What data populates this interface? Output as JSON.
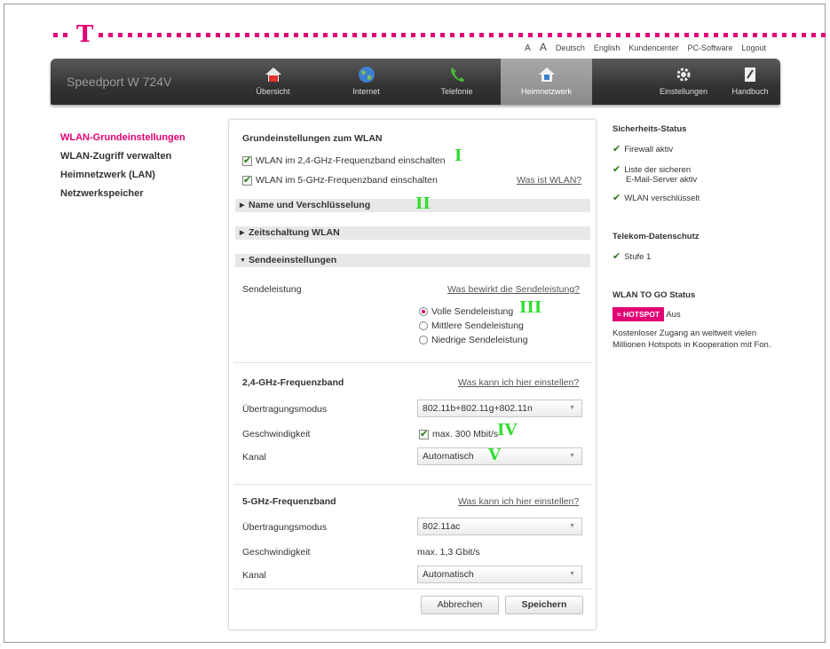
{
  "brand": {
    "logo_letter": "T",
    "accent": "#e20074"
  },
  "toplinks": {
    "font_small": "A",
    "font_large": "A",
    "deutsch": "Deutsch",
    "english": "English",
    "kundencenter": "Kundencenter",
    "pc_software": "PC-Software",
    "logout": "Logout"
  },
  "nav": {
    "product": "Speedport W 724V",
    "tabs": [
      {
        "label": "Übersicht",
        "icon": "home-icon"
      },
      {
        "label": "Internet",
        "icon": "globe-icon"
      },
      {
        "label": "Telefonie",
        "icon": "phone-icon"
      },
      {
        "label": "Heimnetzwerk",
        "icon": "home-network-icon",
        "active": true
      },
      {
        "label": "Einstellungen",
        "icon": "gear-icon"
      },
      {
        "label": "Handbuch",
        "icon": "manual-icon"
      }
    ]
  },
  "leftnav": {
    "items": [
      {
        "label": "WLAN-Grundeinstellungen",
        "active": true
      },
      {
        "label": "WLAN-Zugriff verwalten"
      },
      {
        "label": "Heimnetzwerk (LAN)"
      },
      {
        "label": "Netzwerkspeicher"
      }
    ]
  },
  "main": {
    "title": "Grundeinstellungen zum WLAN",
    "wlan24": "WLAN im 2,4-GHz-Frequenzband einschalten",
    "wlan5": "WLAN im 5-GHz-Frequenzband einschalten",
    "what_is_wlan": "Was ist WLAN?",
    "sections": {
      "name": "Name und Verschlüsselung",
      "timer": "Zeitschaltung WLAN",
      "send": "Sendeeinstellungen"
    },
    "sendeleistung": {
      "label": "Sendeleistung",
      "help": "Was bewirkt die Sendeleistung?",
      "options": [
        "Volle Sendeleistung",
        "Mittlere Sendeleistung",
        "Niedrige Sendeleistung"
      ],
      "selected": "Volle Sendeleistung"
    },
    "band24": {
      "title": "2,4-GHz-Frequenzband",
      "help": "Was kann ich hier einstellen?",
      "mode_label": "Übertragungsmodus",
      "mode_value": "802.11b+802.11g+802.11n",
      "speed_label": "Geschwindigkeit",
      "speed_value": "max. 300 Mbit/s",
      "channel_label": "Kanal",
      "channel_value": "Automatisch"
    },
    "band5": {
      "title": "5-GHz-Frequenzband",
      "help": "Was kann ich hier einstellen?",
      "mode_label": "Übertragungsmodus",
      "mode_value": "802.11ac",
      "speed_label": "Geschwindigkeit",
      "speed_value": "max. 1,3 Gbit/s",
      "channel_label": "Kanal",
      "channel_value": "Automatisch"
    },
    "cancel": "Abbrechen",
    "save": "Speichern"
  },
  "markers": [
    "I",
    "II",
    "III",
    "IV",
    "V"
  ],
  "right": {
    "security_title": "Sicherheits-Status",
    "security_items": [
      "Firewall aktiv",
      "Liste der sicheren",
      "E-Mail-Server aktiv",
      "WLAN verschlüsselt"
    ],
    "privacy_title": "Telekom-Datenschutz",
    "privacy_item": "Stufe 1",
    "togo_title": "WLAN TO GO Status",
    "hotspot": "HOTSPOT",
    "hotspot_state": "Aus",
    "togo_text1": "Kostenloser Zugang an weltweit vielen",
    "togo_text2": "Millionen Hotspots in Kooperation mit Fon."
  }
}
